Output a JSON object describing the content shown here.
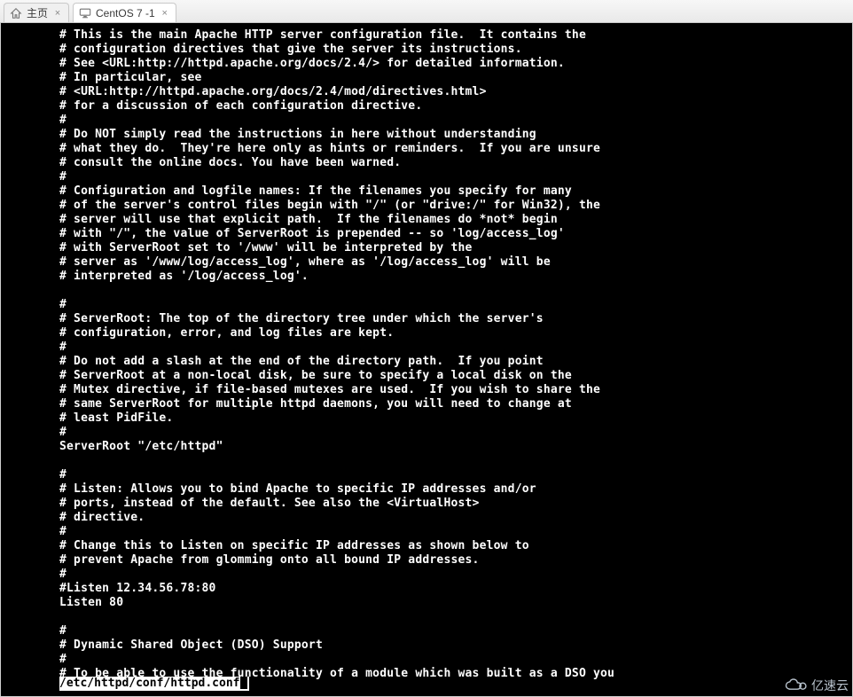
{
  "tabs": {
    "home": {
      "label": "主页"
    },
    "vm": {
      "label": "CentOS 7 -1"
    }
  },
  "terminal": {
    "lines": [
      "# This is the main Apache HTTP server configuration file.  It contains the",
      "# configuration directives that give the server its instructions.",
      "# See <URL:http://httpd.apache.org/docs/2.4/> for detailed information.",
      "# In particular, see",
      "# <URL:http://httpd.apache.org/docs/2.4/mod/directives.html>",
      "# for a discussion of each configuration directive.",
      "#",
      "# Do NOT simply read the instructions in here without understanding",
      "# what they do.  They're here only as hints or reminders.  If you are unsure",
      "# consult the online docs. You have been warned.",
      "#",
      "# Configuration and logfile names: If the filenames you specify for many",
      "# of the server's control files begin with \"/\" (or \"drive:/\" for Win32), the",
      "# server will use that explicit path.  If the filenames do *not* begin",
      "# with \"/\", the value of ServerRoot is prepended -- so 'log/access_log'",
      "# with ServerRoot set to '/www' will be interpreted by the",
      "# server as '/www/log/access_log', where as '/log/access_log' will be",
      "# interpreted as '/log/access_log'.",
      "",
      "#",
      "# ServerRoot: The top of the directory tree under which the server's",
      "# configuration, error, and log files are kept.",
      "#",
      "# Do not add a slash at the end of the directory path.  If you point",
      "# ServerRoot at a non-local disk, be sure to specify a local disk on the",
      "# Mutex directive, if file-based mutexes are used.  If you wish to share the",
      "# same ServerRoot for multiple httpd daemons, you will need to change at",
      "# least PidFile.",
      "#",
      "ServerRoot \"/etc/httpd\"",
      "",
      "#",
      "# Listen: Allows you to bind Apache to specific IP addresses and/or",
      "# ports, instead of the default. See also the <VirtualHost>",
      "# directive.",
      "#",
      "# Change this to Listen on specific IP addresses as shown below to",
      "# prevent Apache from glomming onto all bound IP addresses.",
      "#",
      "#Listen 12.34.56.78:80",
      "Listen 80",
      "",
      "#",
      "# Dynamic Shared Object (DSO) Support",
      "#",
      "# To be able to use the functionality of a module which was built as a DSO you"
    ]
  },
  "statusline": {
    "path": "/etc/httpd/conf/httpd.conf"
  },
  "watermark": {
    "text": "亿速云"
  }
}
